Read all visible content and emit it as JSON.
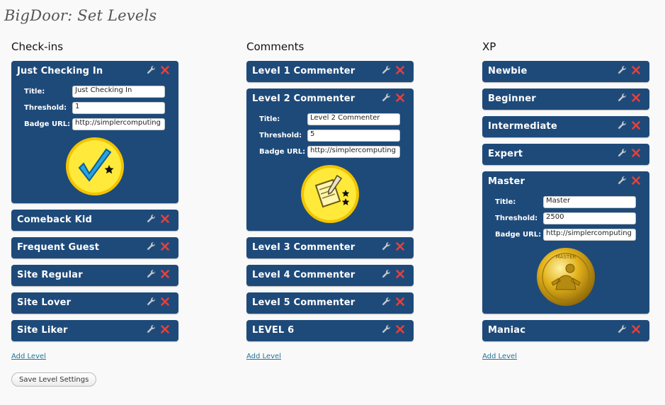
{
  "page_title": "BigDoor: Set Levels",
  "labels": {
    "title": "Title:",
    "threshold": "Threshold:",
    "badge_url": "Badge URL:"
  },
  "add_level": "Add Level",
  "save_button": "Save Level Settings",
  "icons": {
    "edit": "wrench-icon",
    "delete": "delete-x-icon"
  },
  "colors": {
    "panel": "#1e4a7a",
    "delete": "#e8403a",
    "link": "#21759b"
  },
  "columns": [
    {
      "heading": "Check-ins",
      "levels": [
        {
          "name": "Just Checking In",
          "title": "Just Checking In",
          "threshold": "1",
          "badge_url": "http://simplercomputing",
          "badge": "checkmark-badge"
        },
        {
          "name": "Comeback Kid"
        },
        {
          "name": "Frequent Guest"
        },
        {
          "name": "Site Regular"
        },
        {
          "name": "Site Lover"
        },
        {
          "name": "Site Liker"
        }
      ]
    },
    {
      "heading": "Comments",
      "levels": [
        {
          "name": "Level 1 Commenter"
        },
        {
          "name": "Level 2 Commenter",
          "title": "Level 2 Commenter",
          "threshold": "5",
          "badge_url": "http://simplercomputing",
          "badge": "notepad-badge"
        },
        {
          "name": "Level 3 Commenter"
        },
        {
          "name": "Level 4 Commenter"
        },
        {
          "name": "Level 5 Commenter"
        },
        {
          "name": "LEVEL 6"
        }
      ]
    },
    {
      "heading": "XP",
      "levels": [
        {
          "name": "Newbie"
        },
        {
          "name": "Beginner"
        },
        {
          "name": "Intermediate"
        },
        {
          "name": "Expert"
        },
        {
          "name": "Master",
          "title": "Master",
          "threshold": "2500",
          "badge_url": "http://simplercomputing",
          "badge": "gold-medal-badge",
          "badge_text": "MASTER"
        },
        {
          "name": "Maniac"
        }
      ]
    }
  ]
}
